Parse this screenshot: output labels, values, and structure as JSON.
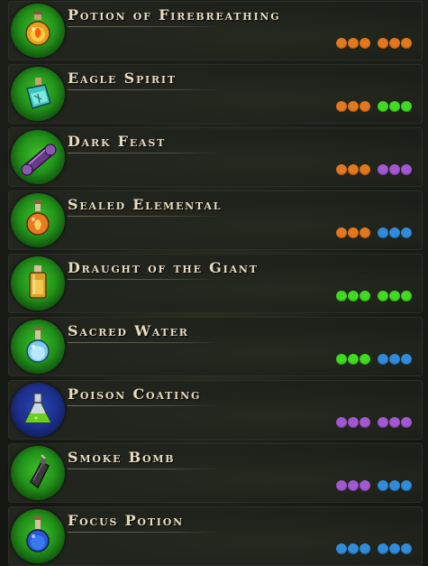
{
  "colors": {
    "orange": "#e8761c",
    "green": "#3fdc1f",
    "purple": "#a355d6",
    "blue": "#2d8be0"
  },
  "recipes": [
    {
      "name": "Potion of Firebreathing",
      "icon": "fire-potion-icon",
      "badge": "green",
      "costs": [
        "orange",
        "orange"
      ]
    },
    {
      "name": "Eagle Spirit",
      "icon": "eagle-spirit-bottle-icon",
      "badge": "green",
      "costs": [
        "orange",
        "green"
      ]
    },
    {
      "name": "Dark Feast",
      "icon": "dark-feast-scroll-icon",
      "badge": "green",
      "costs": [
        "orange",
        "purple"
      ]
    },
    {
      "name": "Sealed Elemental",
      "icon": "sealed-elemental-flask-icon",
      "badge": "green",
      "costs": [
        "orange",
        "blue"
      ]
    },
    {
      "name": "Draught of the Giant",
      "icon": "giant-draught-bottle-icon",
      "badge": "green",
      "costs": [
        "green",
        "green"
      ]
    },
    {
      "name": "Sacred Water",
      "icon": "sacred-water-flask-icon",
      "badge": "green",
      "costs": [
        "green",
        "blue"
      ]
    },
    {
      "name": "Poison Coating",
      "icon": "poison-flask-icon",
      "badge": "blue",
      "costs": [
        "purple",
        "purple"
      ]
    },
    {
      "name": "Smoke Bomb",
      "icon": "smoke-bomb-icon",
      "badge": "green",
      "costs": [
        "purple",
        "blue"
      ]
    },
    {
      "name": "Focus Potion",
      "icon": "focus-potion-flask-icon",
      "badge": "green",
      "costs": [
        "blue",
        "blue"
      ]
    }
  ]
}
